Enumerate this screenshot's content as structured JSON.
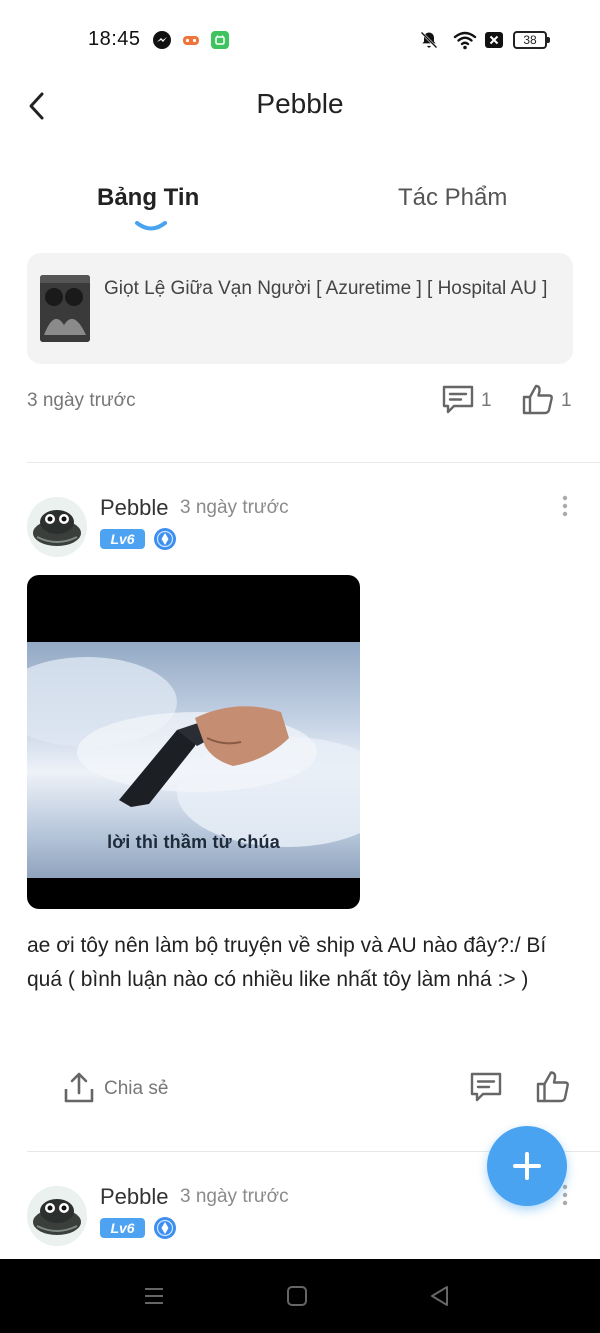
{
  "status_bar": {
    "time": "18:45",
    "battery": "38",
    "left_icons": [
      "messenger-icon",
      "game-controller-icon",
      "app-store-icon"
    ],
    "right_icons": [
      "mute-icon",
      "wifi-icon",
      "no-sim-icon",
      "battery-icon"
    ]
  },
  "header": {
    "title": "Pebble",
    "back_icon": "chevron-left-icon"
  },
  "tabs": [
    {
      "label": "Bảng Tin",
      "active": true
    },
    {
      "label": "Tác Phẩm",
      "active": false
    }
  ],
  "feed": {
    "shared_story": {
      "title": "Giọt Lệ Giữa Vạn Người [ Azuretime ] [ Hospital AU ]",
      "time": "3 ngày trước",
      "comment_count": "1",
      "like_count": "1"
    },
    "posts": [
      {
        "author": "Pebble",
        "time": "3 ngày trước",
        "level": "Lv6",
        "image_caption": "lời thì thầm từ chúa",
        "text": "ae ơi tôy nên làm bộ truyện về ship và AU nào đây?:/ Bí quá ( bình luận nào có nhiều like nhất tôy làm nhá :> )",
        "share_label": "Chia sẻ"
      },
      {
        "author": "Pebble",
        "time": "3 ngày trước",
        "level": "Lv6"
      }
    ]
  },
  "fab": {
    "icon": "plus-icon"
  },
  "nav_bar": {
    "icons": [
      "menu-icon",
      "home-icon",
      "back-triangle-icon"
    ]
  },
  "colors": {
    "accent": "#4aa3f0",
    "level_badge": "#4da3f2",
    "card_bg": "#f3f3f3",
    "muted_text": "#777777",
    "nav_bar": "#000000"
  }
}
